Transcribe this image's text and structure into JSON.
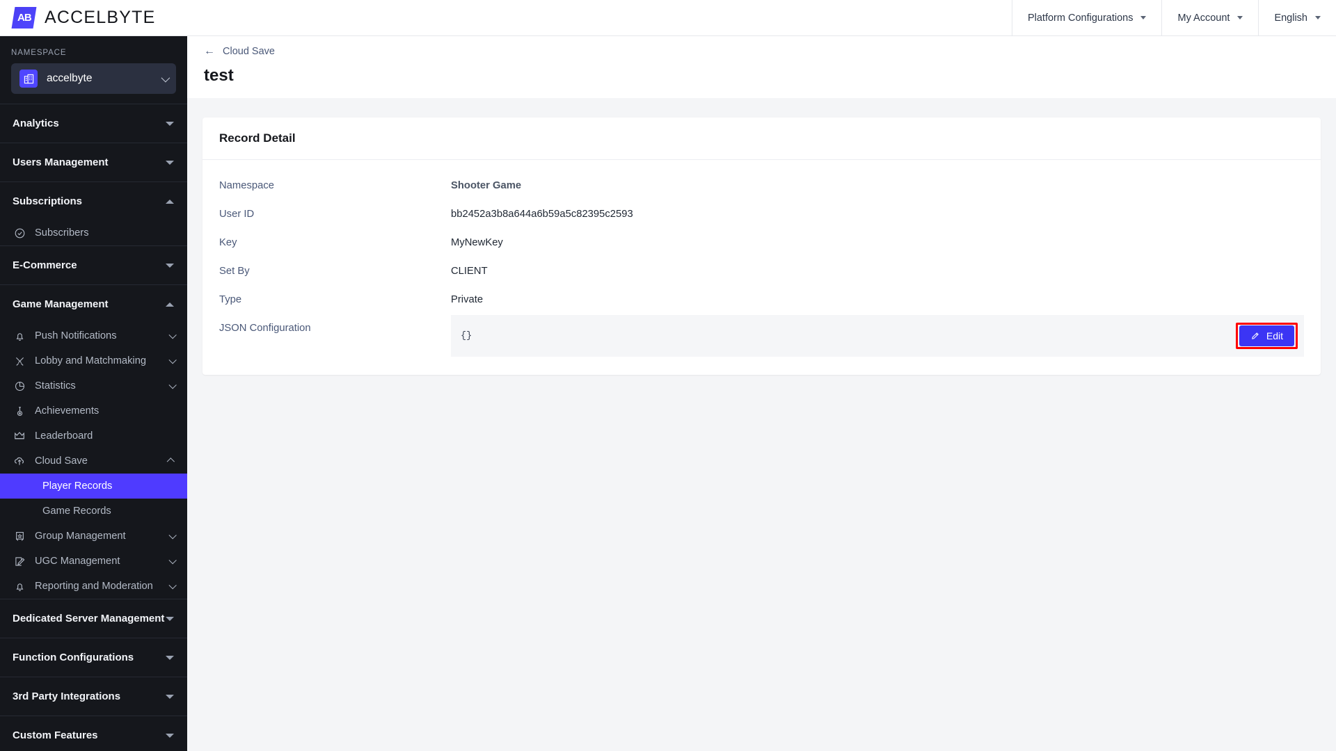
{
  "brand": {
    "logo_glyph": "AB",
    "logo_text": "ACCELBYTE"
  },
  "topbar": {
    "items": [
      {
        "label": "Platform Configurations",
        "icon": "caret-down-icon"
      },
      {
        "label": "My Account",
        "icon": "caret-down-icon"
      },
      {
        "label": "English",
        "icon": "caret-down-icon"
      }
    ]
  },
  "sidebar": {
    "namespace_label": "NAMESPACE",
    "namespace_value": "accelbyte",
    "namespace_icon": "building-icon",
    "sections": [
      {
        "label": "Analytics",
        "state": "collapsed",
        "items": []
      },
      {
        "label": "Users Management",
        "state": "collapsed",
        "items": []
      },
      {
        "label": "Subscriptions",
        "state": "expanded",
        "items": [
          {
            "label": "Subscribers",
            "icon": "check-circle-icon",
            "chevron": ""
          }
        ]
      },
      {
        "label": "E-Commerce",
        "state": "collapsed",
        "items": []
      },
      {
        "label": "Game Management",
        "state": "expanded",
        "items": [
          {
            "label": "Push Notifications",
            "icon": "bell-icon",
            "chevron": "down"
          },
          {
            "label": "Lobby and Matchmaking",
            "icon": "swords-icon",
            "chevron": "down"
          },
          {
            "label": "Statistics",
            "icon": "pie-chart-icon",
            "chevron": "down"
          },
          {
            "label": "Achievements",
            "icon": "medal-icon",
            "chevron": ""
          },
          {
            "label": "Leaderboard",
            "icon": "crown-icon",
            "chevron": ""
          },
          {
            "label": "Cloud Save",
            "icon": "cloud-upload-icon",
            "chevron": "up",
            "children": [
              {
                "label": "Player Records",
                "active": true
              },
              {
                "label": "Game Records",
                "active": false
              }
            ]
          },
          {
            "label": "Group Management",
            "icon": "badge-icon",
            "chevron": "down"
          },
          {
            "label": "UGC Management",
            "icon": "edit-square-icon",
            "chevron": "down"
          },
          {
            "label": "Reporting and Moderation",
            "icon": "bell-icon",
            "chevron": "down"
          }
        ]
      },
      {
        "label": "Dedicated Server Management",
        "state": "collapsed",
        "items": []
      },
      {
        "label": "Function Configurations",
        "state": "collapsed",
        "items": []
      },
      {
        "label": "3rd Party Integrations",
        "state": "collapsed",
        "items": []
      },
      {
        "label": "Custom Features",
        "state": "collapsed",
        "items": []
      }
    ]
  },
  "page": {
    "breadcrumb": "Cloud Save",
    "back_arrow": "←",
    "title": "test"
  },
  "card": {
    "title": "Record Detail",
    "fields": [
      {
        "key": "Namespace",
        "value": "Shooter Game"
      },
      {
        "key": "User ID",
        "value": "bb2452a3b8a644a6b59a5c82395c2593"
      },
      {
        "key": "Key",
        "value": "MyNewKey"
      },
      {
        "key": "Set By",
        "value": "CLIENT"
      },
      {
        "key": "Type",
        "value": "Private"
      }
    ],
    "json_field": {
      "key": "JSON Configuration",
      "value": "{}",
      "edit_label": "Edit",
      "edit_icon": "pencil-icon"
    }
  },
  "colors": {
    "accent": "#4f3bff",
    "button": "#3b35f4",
    "highlight": "#ff0000",
    "sidebar_bg": "#15171c",
    "page_bg": "#f4f5f7"
  }
}
